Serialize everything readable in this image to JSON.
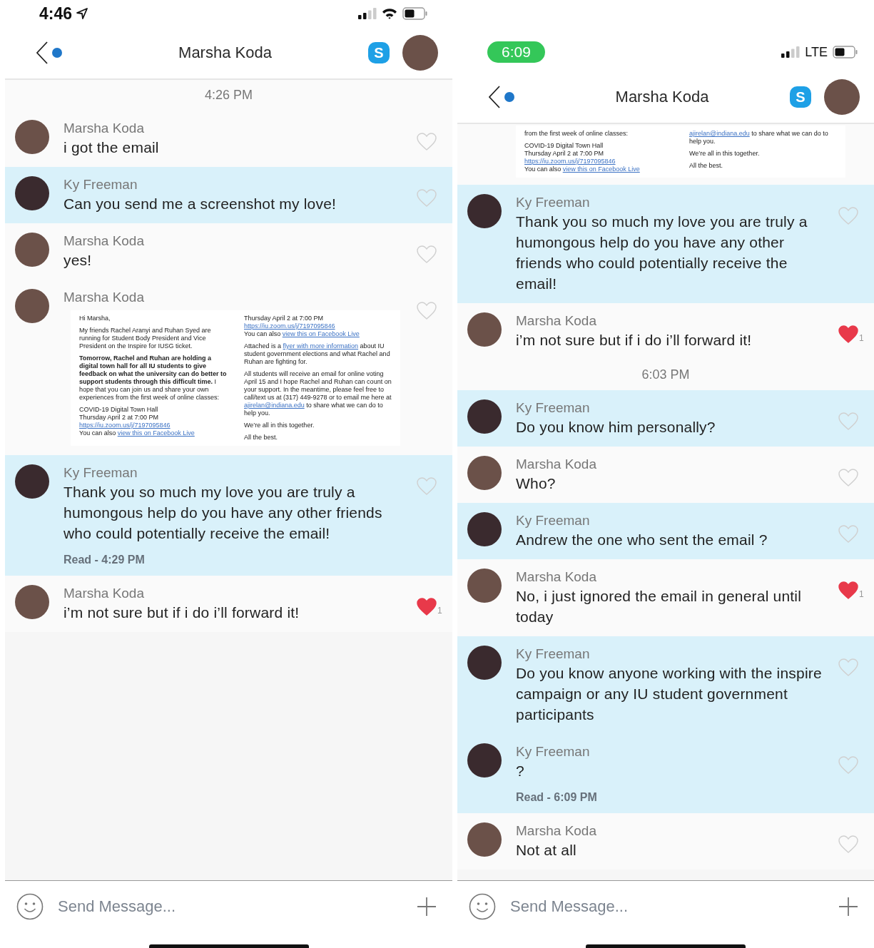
{
  "phones": [
    {
      "status_bar": {
        "time": "4:46",
        "kind": "plain"
      },
      "header": {
        "title": "Marsha Koda",
        "unread": true,
        "app_icon_letter": "S"
      },
      "items": [
        {
          "kind": "timestamp",
          "text": "4:26 PM"
        },
        {
          "kind": "message",
          "sender": "Marsha Koda",
          "text": "i got the email",
          "outgoing": false,
          "liked": false
        },
        {
          "kind": "message",
          "sender": "Ky Freeman",
          "text": "Can you send me a screenshot my love!",
          "outgoing": true,
          "liked": false
        },
        {
          "kind": "message",
          "sender": "Marsha Koda",
          "text": "yes!",
          "outgoing": false,
          "liked": false
        },
        {
          "kind": "email",
          "sender": "Marsha Koda",
          "outgoing": false,
          "liked": false,
          "columns": [
            [
              [
                [
                  {
                    "kind": "plain",
                    "text": "Hi Marsha,"
                  }
                ]
              ],
              [
                [
                  {
                    "kind": "plain",
                    "text": "My friends Rachel Aranyi and Ruhan Syed are running for Student Body President and Vice President on the Inspire for IUSG ticket."
                  }
                ]
              ],
              [
                [
                  {
                    "kind": "bold",
                    "text": "Tomorrow, Rachel and Ruhan are holding a digital town hall for all IU students to give feedback on what the university can do better to support students through this difficult time."
                  },
                  {
                    "kind": "plain",
                    "text": " I hope that you can join us and share your own experiences from the first week of online classes:"
                  }
                ]
              ],
              [
                [
                  {
                    "kind": "plain",
                    "text": "COVID-19 Digital Town Hall"
                  }
                ],
                [
                  {
                    "kind": "plain",
                    "text": "Thursday April 2 at 7:00 PM"
                  }
                ],
                [
                  {
                    "kind": "link",
                    "text": "https://iu.zoom.us/j/7197095846"
                  }
                ],
                [
                  {
                    "kind": "plain",
                    "text": "You can also "
                  },
                  {
                    "kind": "link",
                    "text": "view this on Facebook Live"
                  }
                ]
              ]
            ],
            [
              [
                [
                  {
                    "kind": "plain",
                    "text": "Thursday April 2 at 7:00 PM"
                  }
                ],
                [
                  {
                    "kind": "link",
                    "text": "https://iu.zoom.us/j/7197095846"
                  }
                ],
                [
                  {
                    "kind": "plain",
                    "text": "You can also "
                  },
                  {
                    "kind": "link",
                    "text": "view this on Facebook Live"
                  }
                ]
              ],
              [
                [
                  {
                    "kind": "plain",
                    "text": "Attached is a "
                  },
                  {
                    "kind": "link",
                    "text": "flyer with more information"
                  },
                  {
                    "kind": "plain",
                    "text": " about IU student government elections and what Rachel and Ruhan are fighting for."
                  }
                ]
              ],
              [
                [
                  {
                    "kind": "plain",
                    "text": "All students will receive an email for online voting April 15 and I hope Rachel and Ruhan can count on your support. In the meantime, please feel free to call/text us at (317) 449-9278 or to email me here at "
                  },
                  {
                    "kind": "link",
                    "text": "ajirelan@indiana.edu"
                  },
                  {
                    "kind": "plain",
                    "text": " to share what we can do to help you."
                  }
                ]
              ],
              [
                [
                  {
                    "kind": "plain",
                    "text": "We’re all in this together."
                  }
                ]
              ],
              [
                [
                  {
                    "kind": "plain",
                    "text": "All the best."
                  }
                ]
              ]
            ]
          ]
        },
        {
          "kind": "message",
          "sender": "Ky Freeman",
          "text": "Thank you so much my love you are truly a humongous help do you have any other friends who could potentially receive the email!",
          "outgoing": true,
          "liked": false,
          "read": "Read - 4:29 PM"
        },
        {
          "kind": "message",
          "sender": "Marsha Koda",
          "text": "i’m not sure but if i do i’ll forward it!",
          "outgoing": false,
          "liked": true,
          "like_count": "1"
        }
      ],
      "composer": {
        "placeholder": "Send Message..."
      }
    },
    {
      "status_bar": {
        "time": "6:09",
        "kind": "pill",
        "network_label": "LTE"
      },
      "header": {
        "title": "Marsha Koda",
        "unread": true,
        "app_icon_letter": "S"
      },
      "items": [
        {
          "kind": "email_fragment",
          "columns": [
            [
              [
                [
                  {
                    "kind": "plain",
                    "text": "from the first week of online classes:"
                  }
                ]
              ],
              [
                [
                  {
                    "kind": "plain",
                    "text": "COVID-19 Digital Town Hall"
                  }
                ],
                [
                  {
                    "kind": "plain",
                    "text": "Thursday April 2 at 7:00 PM"
                  }
                ],
                [
                  {
                    "kind": "link",
                    "text": "https://iu.zoom.us/j/7197095846"
                  }
                ],
                [
                  {
                    "kind": "plain",
                    "text": "You can also "
                  },
                  {
                    "kind": "link",
                    "text": "view this on Facebook Live"
                  }
                ]
              ]
            ],
            [
              [
                [
                  {
                    "kind": "link",
                    "text": "ajirelan@indiana.edu"
                  },
                  {
                    "kind": "plain",
                    "text": " to share what we can do to help you."
                  }
                ]
              ],
              [
                [
                  {
                    "kind": "plain",
                    "text": "We’re all in this together."
                  }
                ]
              ],
              [
                [
                  {
                    "kind": "plain",
                    "text": "All the best."
                  }
                ]
              ]
            ]
          ]
        },
        {
          "kind": "message",
          "sender": "Ky Freeman",
          "text": "Thank you so much my love you are truly a humongous help do you have any other friends who could potentially receive the email!",
          "outgoing": true,
          "liked": false
        },
        {
          "kind": "message",
          "sender": "Marsha Koda",
          "text": "i’m not sure but if i do i’ll forward it!",
          "outgoing": false,
          "liked": true,
          "like_count": "1"
        },
        {
          "kind": "timestamp",
          "text": "6:03 PM"
        },
        {
          "kind": "message",
          "sender": "Ky Freeman",
          "text": "Do you know him personally?",
          "outgoing": true,
          "liked": false
        },
        {
          "kind": "message",
          "sender": "Marsha Koda",
          "text": "Who?",
          "outgoing": false,
          "liked": false
        },
        {
          "kind": "message",
          "sender": "Ky Freeman",
          "text": "Andrew the one who sent the email ?",
          "outgoing": true,
          "liked": false
        },
        {
          "kind": "message",
          "sender": "Marsha Koda",
          "text": "No, i just ignored the email in general until today",
          "outgoing": false,
          "liked": true,
          "like_count": "1"
        },
        {
          "kind": "message",
          "sender": "Ky Freeman",
          "text": "Do you know anyone working with the inspire campaign or any IU student government participants",
          "outgoing": true,
          "liked": false
        },
        {
          "kind": "message",
          "sender": "Ky Freeman",
          "text": "?",
          "outgoing": true,
          "liked": false,
          "read": "Read - 6:09 PM"
        },
        {
          "kind": "message",
          "sender": "Marsha Koda",
          "text": "Not at all",
          "outgoing": false,
          "liked": false
        }
      ],
      "composer": {
        "placeholder": "Send Message..."
      }
    }
  ]
}
